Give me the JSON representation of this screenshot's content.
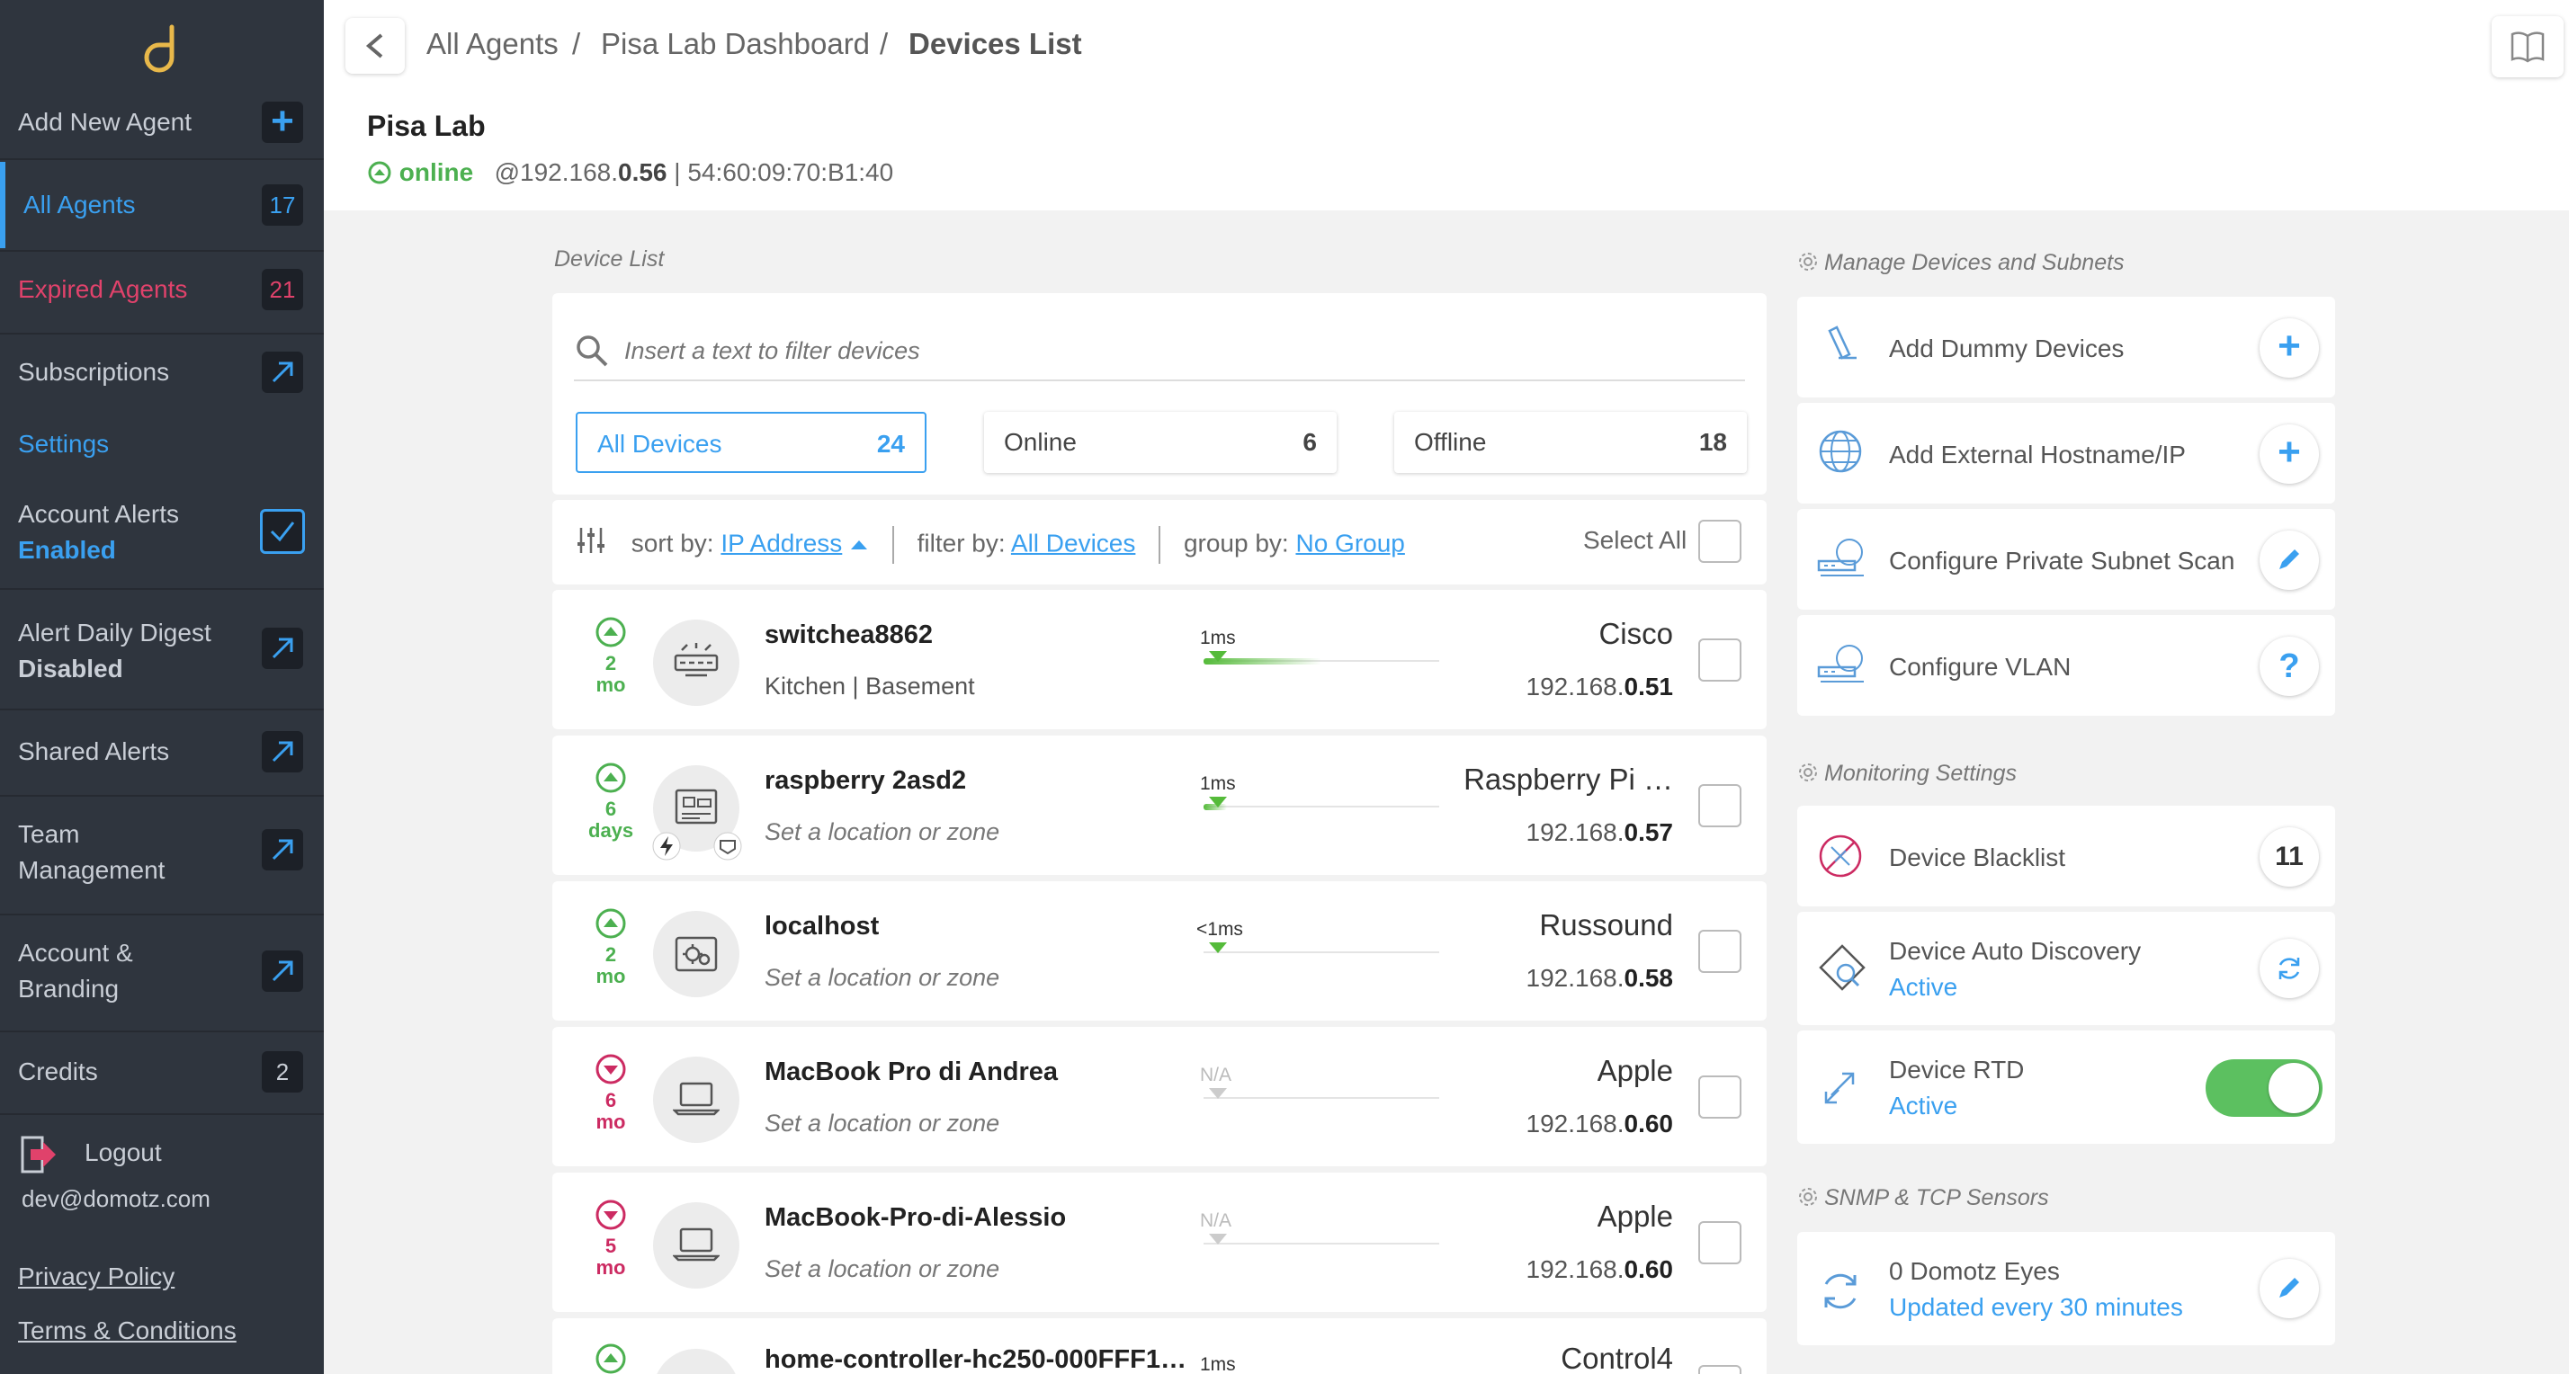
{
  "sidebar": {
    "add_agent": {
      "label": "Add New Agent",
      "badge": "+"
    },
    "all_agents": {
      "label": "All Agents",
      "count": "17"
    },
    "expired_agents": {
      "label": "Expired Agents",
      "count": "21"
    },
    "subscriptions": {
      "label": "Subscriptions"
    },
    "settings_label": "Settings",
    "account_alerts": {
      "label": "Account Alerts",
      "status": "Enabled"
    },
    "alert_digest": {
      "label": "Alert Daily Digest",
      "status": "Disabled"
    },
    "shared_alerts": {
      "label": "Shared Alerts"
    },
    "team_management": {
      "line1": "Team",
      "line2": "Management"
    },
    "account_branding": {
      "line1": "Account &",
      "line2": "Branding"
    },
    "credits": {
      "label": "Credits",
      "count": "2"
    },
    "logout": {
      "label": "Logout",
      "email": "dev@domotz.com"
    },
    "privacy_policy": "Privacy Policy",
    "terms": "Terms & Conditions"
  },
  "header": {
    "breadcrumbs": [
      "All Agents",
      "Pisa Lab Dashboard",
      "Devices List"
    ],
    "agent_name": "Pisa Lab",
    "status": "online",
    "ip_prefix": "@192.168.",
    "ip_suffix": "0.56",
    "mac": "| 54:60:09:70:B1:40"
  },
  "device_list": {
    "section_label": "Device List",
    "search_placeholder": "Insert a text to filter devices",
    "tabs": [
      {
        "label": "All Devices",
        "count": "24"
      },
      {
        "label": "Online",
        "count": "6"
      },
      {
        "label": "Offline",
        "count": "18"
      }
    ],
    "sort_label": "sort by:",
    "sort_value": "IP Address",
    "filter_label": "filter by:",
    "filter_value": "All Devices",
    "group_label": "group by:",
    "group_value": "No Group",
    "select_all": "Select All",
    "devices": [
      {
        "status": "up",
        "age_num": "2",
        "age_unit": "mo",
        "name": "switchea8862",
        "location": "Kitchen | Basement",
        "latency": "1ms",
        "latency_fraction": 0.5,
        "vendor": "Cisco",
        "ip_prefix": "192.168.",
        "ip_suffix": "0.51"
      },
      {
        "status": "up",
        "age_num": "6",
        "age_unit": "days",
        "name": "raspberry 2asd2",
        "location": "Set a location or zone",
        "latency": "1ms",
        "latency_fraction": 0.1,
        "vendor": "Raspberry Pi …",
        "ip_prefix": "192.168.",
        "ip_suffix": "0.57"
      },
      {
        "status": "up",
        "age_num": "2",
        "age_unit": "mo",
        "name": "localhost",
        "location": "Set a location or zone",
        "latency": "<1ms",
        "latency_fraction": 0.0,
        "vendor": "Russound",
        "ip_prefix": "192.168.",
        "ip_suffix": "0.58"
      },
      {
        "status": "down",
        "age_num": "6",
        "age_unit": "mo",
        "name": "MacBook Pro di Andrea",
        "location": "Set a location or zone",
        "latency": "N/A",
        "latency_fraction": 0.0,
        "vendor": "Apple",
        "ip_prefix": "192.168.",
        "ip_suffix": "0.60"
      },
      {
        "status": "down",
        "age_num": "5",
        "age_unit": "mo",
        "name": "MacBook-Pro-di-Alessio",
        "location": "Set a location or zone",
        "latency": "N/A",
        "latency_fraction": 0.0,
        "vendor": "Apple",
        "ip_prefix": "192.168.",
        "ip_suffix": "0.60"
      },
      {
        "status": "up",
        "age_num": "",
        "age_unit": "",
        "name": "home-controller-hc250-000FFF1…",
        "location": "",
        "latency": "1ms",
        "latency_fraction": 0.0,
        "vendor": "Control4",
        "ip_prefix": "",
        "ip_suffix": ""
      }
    ]
  },
  "right_panel": {
    "manage_label": "Manage Devices and Subnets",
    "manage_items": [
      {
        "label": "Add Dummy Devices",
        "icon": "dummy-device-icon",
        "action": "plus"
      },
      {
        "label": "Add External Hostname/IP",
        "icon": "globe-icon",
        "action": "plus"
      },
      {
        "label": "Configure Private Subnet Scan",
        "icon": "subnet-icon",
        "action": "edit"
      },
      {
        "label": "Configure VLAN",
        "icon": "vlan-icon",
        "action": "help"
      }
    ],
    "monitoring_label": "Monitoring Settings",
    "blacklist": {
      "label": "Device Blacklist",
      "count": "11"
    },
    "auto_discovery": {
      "label": "Device Auto Discovery",
      "status": "Active"
    },
    "rtd": {
      "label": "Device RTD",
      "status": "Active",
      "enabled": true
    },
    "snmp_label": "SNMP & TCP Sensors",
    "domotz_eyes": {
      "label": "0 Domotz Eyes",
      "status": "Updated every 30 minutes"
    }
  },
  "colors": {
    "accent": "#3aa0f0",
    "online": "#4cb050",
    "offline": "#cc2b62",
    "sidebar_bg": "#2f353e",
    "expired": "#e0426b"
  }
}
